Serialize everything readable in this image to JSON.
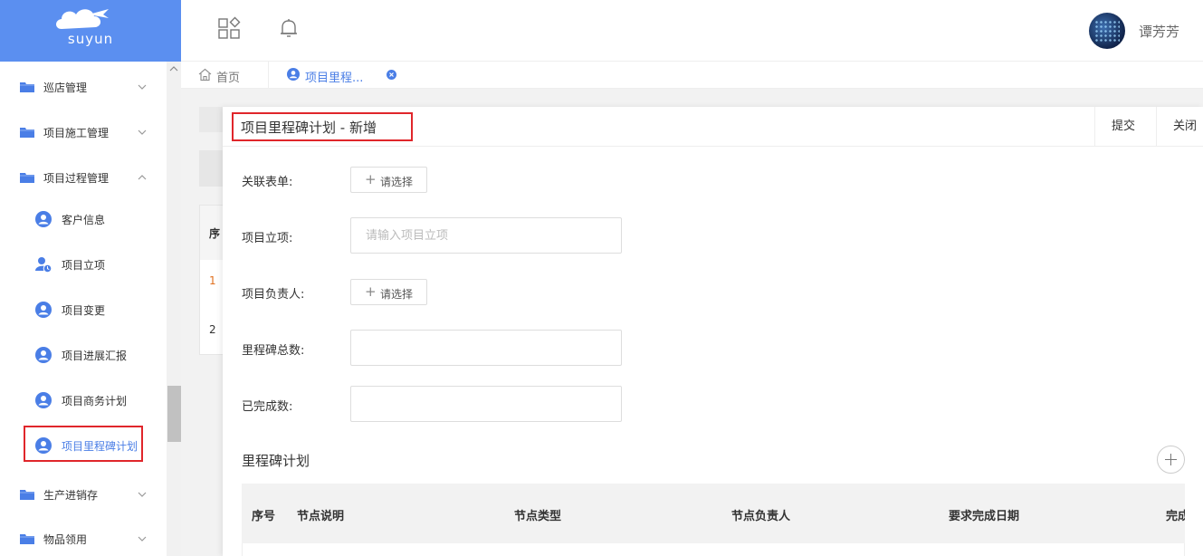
{
  "app": {
    "brand": "suyun",
    "user_name": "谭芳芳"
  },
  "header": {
    "apps_icon": "grid-diamond-icon",
    "bell_icon": "bell-icon"
  },
  "sidebar": {
    "menus": [
      {
        "label": "巡店管理",
        "expanded": false
      },
      {
        "label": "项目施工管理",
        "expanded": false
      },
      {
        "label": "项目过程管理",
        "expanded": true
      },
      {
        "label": "生产进销存",
        "expanded": false
      },
      {
        "label": "物品领用",
        "expanded": false
      }
    ],
    "sub_items": [
      {
        "label": "客户信息",
        "icon": "user-circle-icon"
      },
      {
        "label": "项目立项",
        "icon": "user-clock-icon"
      },
      {
        "label": "项目变更",
        "icon": "user-circle-icon"
      },
      {
        "label": "项目进展汇报",
        "icon": "user-circle-icon"
      },
      {
        "label": "项目商务计划",
        "icon": "user-circle-icon"
      },
      {
        "label": "项目里程碑计划",
        "icon": "user-circle-icon",
        "active": true
      }
    ]
  },
  "tabs": {
    "home": "首页",
    "current": "项目里程..."
  },
  "background": {
    "row1": "1",
    "row2": "2",
    "header_col": "序"
  },
  "dialog": {
    "title": "项目里程碑计划 - 新增",
    "submit": "提交",
    "close": "关闭",
    "fields": {
      "related_form": {
        "label": "关联表单:",
        "button": "请选择"
      },
      "project": {
        "label": "项目立项:",
        "placeholder": "请输入项目立项"
      },
      "owner": {
        "label": "项目负责人:",
        "button": "请选择"
      },
      "total": {
        "label": "里程碑总数:"
      },
      "completed": {
        "label": "已完成数:"
      }
    },
    "section_title": "里程碑计划",
    "table_headers": [
      "序号",
      "节点说明",
      "节点类型",
      "节点负责人",
      "要求完成日期",
      "完成"
    ]
  },
  "colors": {
    "brand": "#5b8ff0",
    "accent": "#4a7ee6",
    "highlight": "#e0262b"
  }
}
